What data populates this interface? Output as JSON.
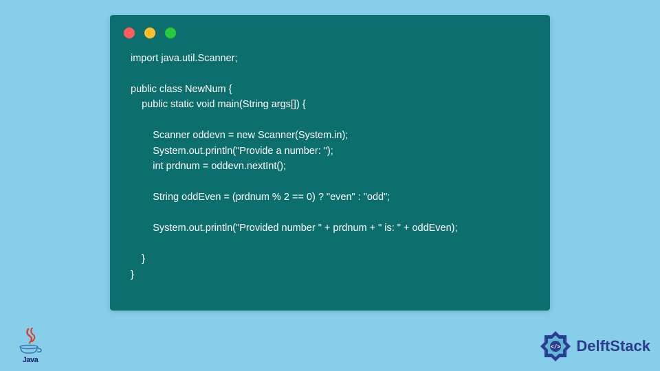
{
  "code": {
    "line1": "import java.util.Scanner;",
    "line2": "",
    "line3": "public class NewNum {",
    "line4": "    public static void main(String args[]) {",
    "line5": "",
    "line6": "        Scanner oddevn = new Scanner(System.in);",
    "line7": "        System.out.println(\"Provide a number: \");",
    "line8": "        int prdnum = oddevn.nextInt();",
    "line9": "",
    "line10": "        String oddEven = (prdnum % 2 == 0) ? \"even\" : \"odd\";",
    "line11": "",
    "line12": "        System.out.println(\"Provided number \" + prdnum + \" is: \" + oddEven);",
    "line13": "",
    "line14": "    }",
    "line15": "}"
  },
  "logos": {
    "java_label": "Java",
    "delft_label": "DelftStack"
  }
}
